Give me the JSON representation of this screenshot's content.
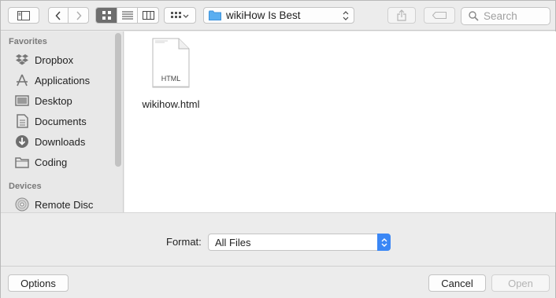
{
  "toolbar": {
    "path_label": "wikiHow Is Best",
    "search_placeholder": "Search"
  },
  "sidebar": {
    "favorites_header": "Favorites",
    "favorites": [
      {
        "label": "Dropbox",
        "icon": "dropbox-icon"
      },
      {
        "label": "Applications",
        "icon": "applications-icon"
      },
      {
        "label": "Desktop",
        "icon": "desktop-icon"
      },
      {
        "label": "Documents",
        "icon": "documents-icon"
      },
      {
        "label": "Downloads",
        "icon": "downloads-icon"
      },
      {
        "label": "Coding",
        "icon": "folder-icon"
      }
    ],
    "devices_header": "Devices",
    "devices": [
      {
        "label": "Remote Disc",
        "icon": "remote-disc-icon"
      }
    ]
  },
  "files": [
    {
      "name": "wikihow.html",
      "type_label": "HTML"
    }
  ],
  "format": {
    "label": "Format:",
    "value": "All Files"
  },
  "buttons": {
    "options": "Options",
    "cancel": "Cancel",
    "open": "Open"
  },
  "colors": {
    "accent": "#3b87f5",
    "folder": "#5aaef0"
  }
}
